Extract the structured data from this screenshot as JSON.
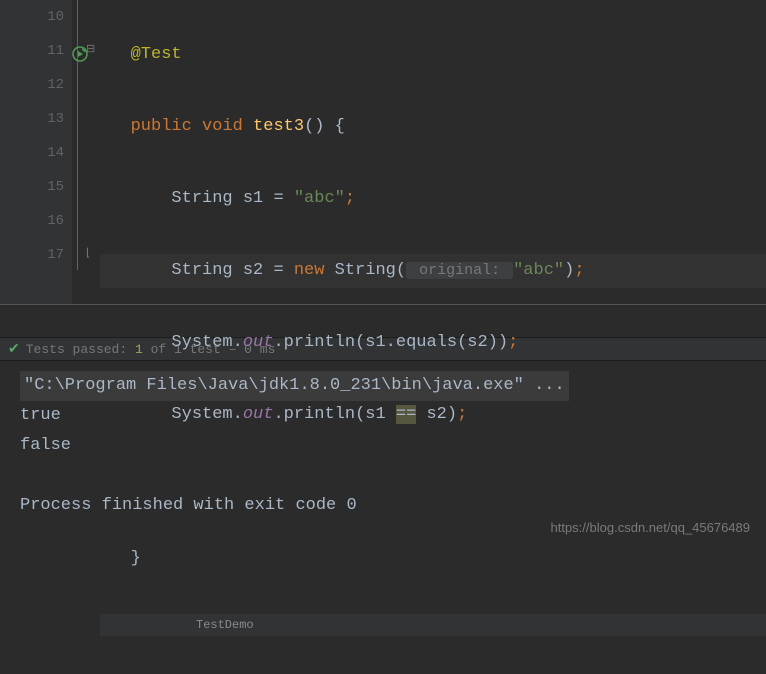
{
  "gutter": {
    "lines": [
      "10",
      "11",
      "12",
      "13",
      "14",
      "15",
      "16",
      "17"
    ]
  },
  "code": {
    "l10": {
      "annotation": "@Test"
    },
    "l11": {
      "kw1": "public ",
      "kw2": "void ",
      "name": "test3",
      "rest": "() {"
    },
    "l12": {
      "pre": "String s1 = ",
      "str": "\"abc\"",
      "semi": ";"
    },
    "l13": {
      "pre": "String s2 = ",
      "kw": "new ",
      "ctor": "String(",
      "hint": " original: ",
      "str": "\"abc\"",
      "close": ")",
      "semi": ";"
    },
    "l14": {
      "sys": "System.",
      "out": "out",
      "dot": ".println(s1.equals(s2))",
      "semi": ";"
    },
    "l15": {
      "sys": "System.",
      "out": "out",
      "dot1": ".println(s1 ",
      "eq": "==",
      "dot2": " s2)",
      "semi": ";"
    },
    "l17": {
      "brace": "}"
    }
  },
  "breadcrumb": {
    "label": "TestDemo"
  },
  "testbar": {
    "prefix": "Tests passed: ",
    "green": "1",
    "suffix": " of 1 test – 0 ms"
  },
  "console": {
    "line1": "\"C:\\Program Files\\Java\\jdk1.8.0_231\\bin\\java.exe\" ...",
    "line2": "true",
    "line3": "false",
    "line4": "Process finished with exit code 0"
  },
  "watermark": "https://blog.csdn.net/qq_45676489"
}
